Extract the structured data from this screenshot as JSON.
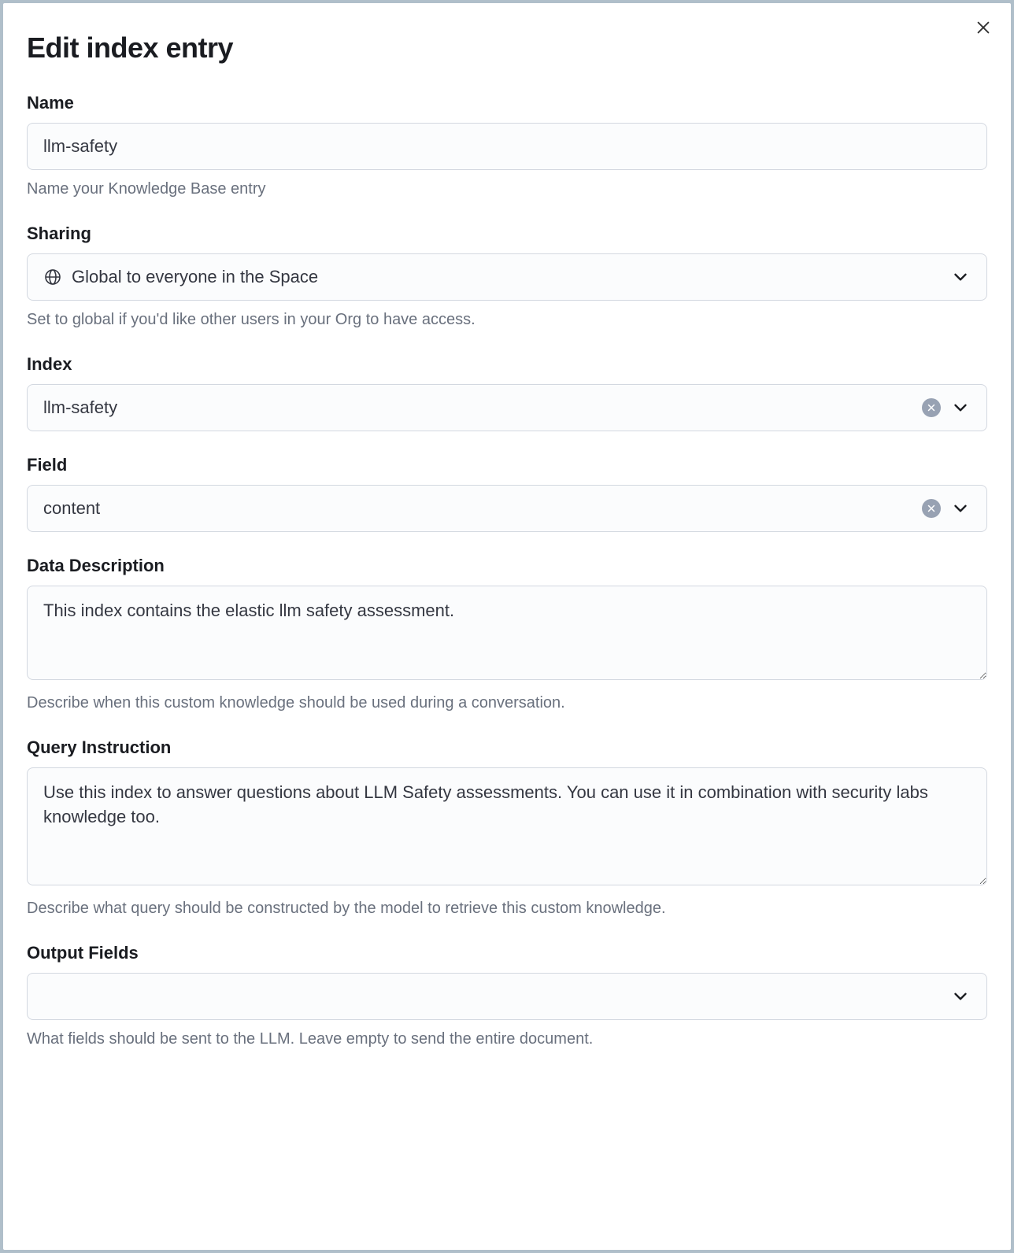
{
  "dialog": {
    "title": "Edit index entry"
  },
  "name": {
    "label": "Name",
    "value": "llm-safety",
    "help": "Name your Knowledge Base entry"
  },
  "sharing": {
    "label": "Sharing",
    "value": "Global to everyone in the Space",
    "help": "Set to global if you'd like other users in your Org to have access."
  },
  "index": {
    "label": "Index",
    "value": "llm-safety"
  },
  "field": {
    "label": "Field",
    "value": "content"
  },
  "dataDescription": {
    "label": "Data Description",
    "value": "This index contains the elastic llm safety assessment.",
    "help": "Describe when this custom knowledge should be used during a conversation."
  },
  "queryInstruction": {
    "label": "Query Instruction",
    "value": "Use this index to answer questions about LLM Safety assessments. You can use it in combination with security labs knowledge too.",
    "help": "Describe what query should be constructed by the model to retrieve this custom knowledge."
  },
  "outputFields": {
    "label": "Output Fields",
    "value": "",
    "help": "What fields should be sent to the LLM. Leave empty to send the entire document."
  }
}
